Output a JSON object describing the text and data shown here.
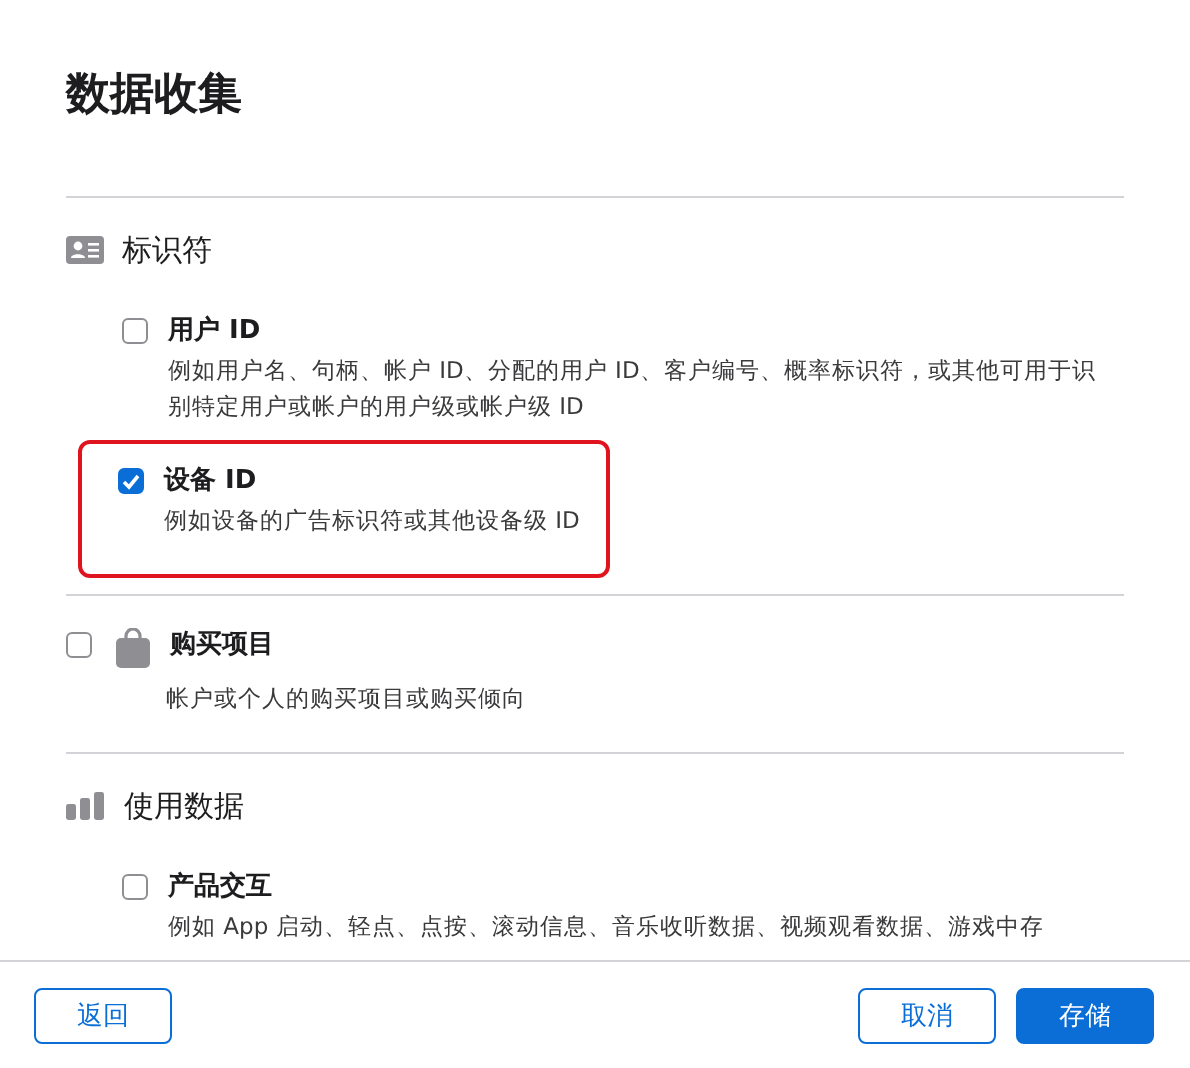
{
  "title": "数据收集",
  "sections": [
    {
      "kind": "group",
      "title": "标识符",
      "items": [
        {
          "label": "用户 ID",
          "description": "例如用户名、句柄、帐户 ID、分配的用户 ID、客户编号、概率标识符，或其他可用于识别特定用户或帐户的用户级或帐户级 ID",
          "checked": false,
          "highlighted": false
        },
        {
          "label": "设备 ID",
          "description": "例如设备的广告标识符或其他设备级 ID",
          "checked": true,
          "highlighted": true
        }
      ]
    },
    {
      "kind": "item",
      "label": "购买项目",
      "description": "帐户或个人的购买项目或购买倾向",
      "checked": false
    },
    {
      "kind": "group",
      "title": "使用数据",
      "items": [
        {
          "label": "产品交互",
          "description": "例如 App 启动、轻点、点按、滚动信息、音乐收听数据、视频观看数据、游戏中存",
          "checked": false,
          "highlighted": false
        }
      ]
    }
  ],
  "footer": {
    "back": "返回",
    "cancel": "取消",
    "save": "存储"
  }
}
